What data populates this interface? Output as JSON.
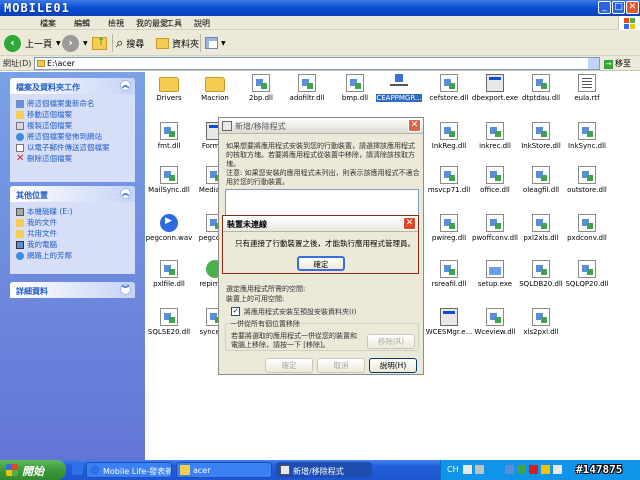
{
  "watermark_logo": "MOBILE01",
  "menu": [
    "檔案",
    "編輯",
    "檢視",
    "我的最愛",
    "工具",
    "說明"
  ],
  "toolbar": {
    "back": "上一頁",
    "search": "搜尋",
    "folders": "資料夾"
  },
  "address": {
    "label": "網址(D)",
    "value": "E:\\acer",
    "go": "移至"
  },
  "left_panels": [
    {
      "title": "檔案及資料夾工作",
      "items": [
        {
          "label": "將這個檔案重新命名",
          "icon": "rename-icon"
        },
        {
          "label": "移動這個檔案",
          "icon": "move-icon"
        },
        {
          "label": "複製這個檔案",
          "icon": "copy-icon"
        },
        {
          "label": "將這個檔案發佈到網站",
          "icon": "publish-icon"
        },
        {
          "label": "以電子郵件傳送這個檔案",
          "icon": "email-icon"
        },
        {
          "label": "刪除這個檔案",
          "icon": "delete-icon"
        }
      ]
    },
    {
      "title": "其他位置",
      "items": [
        {
          "label": "本機磁碟 (E:)",
          "icon": "drive-icon"
        },
        {
          "label": "我的文件",
          "icon": "folder-icon"
        },
        {
          "label": "共用文件",
          "icon": "folder-icon"
        },
        {
          "label": "我的電腦",
          "icon": "computer-icon"
        },
        {
          "label": "網路上的芳鄰",
          "icon": "network-icon"
        }
      ]
    },
    {
      "title": "詳細資料",
      "items": []
    }
  ],
  "files": [
    "Drivers",
    "Macrion",
    "2bp.dll",
    "adofiltr.dll",
    "bmp.dll",
    "CEAPPMGR...",
    "cefstore.dll",
    "dbexport.exe",
    "dtptdau.dll",
    "eula.rtf",
    "fmt.dll",
    "Formi...",
    "InkReg.dll",
    "inkrec.dll",
    "InkStore.dll",
    "InkSync.dll",
    "MailSync.dll",
    "MediaS...",
    "msvcp71.dll",
    "office.dll",
    "oleagfil.dll",
    "outstore.dll",
    "pegconn.wav",
    "pegcon...",
    "pwireg.dll",
    "pwoffconv.dll",
    "pxl2xls.dll",
    "pxdconv.dll",
    "pxlfile.dll",
    "repimg...",
    "rsreafil.dll",
    "setup.exe",
    "SQLDB20.dll",
    "SQLQP20.dll",
    "SQLSE20.dll",
    "syncex...",
    "WCESMgr.e...",
    "Wceview.dll",
    "xls2pxl.dll"
  ],
  "dialog_main": {
    "title": "新增/移除程式",
    "para1": "如果想要將應用程式安裝到您的行動裝置，請選擇該應用程式的核取方塊。若要將應用程式從裝置中移除，請清除該核取方塊。",
    "para2": "注意: 如果您安裝的應用程式未列出，則表示該應用程式不適合用於您的行動裝置。",
    "space_label": "選定應用程式所需的空間:",
    "avail_label": "裝置上的可用空間:",
    "checkbox_label": "將應用程式安裝至預設安裝資料夾(I)",
    "group_title": "一併從所有個位置移除",
    "group_text": "若要將選取的應用程式一併從您的裝置和電腦上移除，請按一下 [移除]。",
    "remove_btn": "移除(R)",
    "ok_btn": "確定",
    "cancel_btn": "取消",
    "help_btn": "說明(H)"
  },
  "dialog_alert": {
    "title": "裝置未連線",
    "message": "只有連接了行動裝置之後，才能執行應用程式管理員。",
    "ok_btn": "確定"
  },
  "taskbar": {
    "start": "開始",
    "tasks": [
      "Mobile Life-發表新主...",
      "acer",
      "新增/移除程式"
    ],
    "lang": "CH"
  },
  "watermark_id": "#147875"
}
